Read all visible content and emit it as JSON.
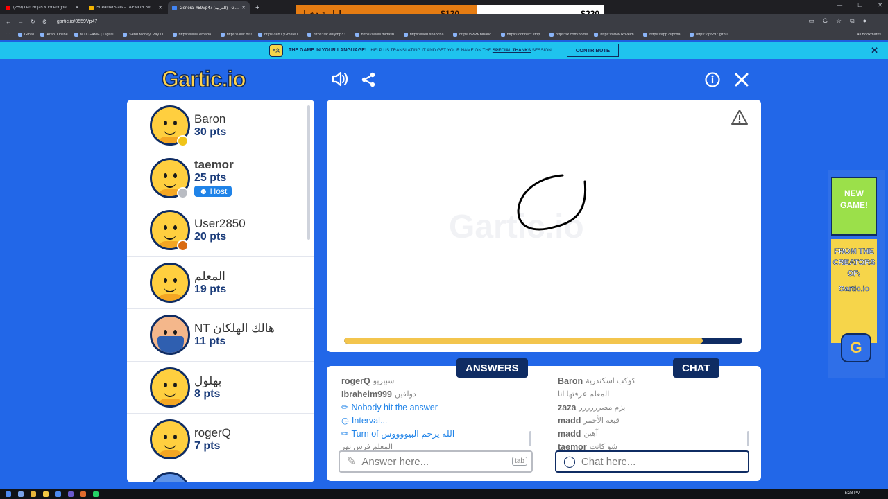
{
  "browser": {
    "tabs": [
      {
        "title": "(259) Leo Rojas & Gheorghe",
        "favicon_color": "#ff0000",
        "active": false
      },
      {
        "title": "StreamerStats - TAEMOR Stream",
        "favicon_color": "#f4b400",
        "active": false
      },
      {
        "title": "General #59Vp47 (العربية) - Gartic",
        "favicon_color": "#4285f4",
        "active": true
      }
    ],
    "new_tab": "+",
    "url": "gartic.io/0559Vp47",
    "bookmarks": [
      "Gmail",
      "Arabi Online",
      "MTCGAME | Digital...",
      "Send Money, Pay O...",
      "https://www.emada...",
      "https://3isk.biz/",
      "https://en1.y2mate.i...",
      "https://ar.onlymp3.t...",
      "https://www.midasb...",
      "https://web.snapcha...",
      "https://www.binanc...",
      "https://connect.strip...",
      "https://x.com/home",
      "https://www.ikoveim...",
      "https://app.clipcha...",
      "https://tpr297.githu..."
    ],
    "all_bookmarks": "All Bookmarks"
  },
  "overlay": {
    "label": "اولوية دخول",
    "left_amount": "$130",
    "right_amount": "$220"
  },
  "banner": {
    "lead": "THE GAME IN YOUR LANGUAGE!",
    "help": "HELP US TRANSLATING IT AND GET YOUR NAME ON THE",
    "special": "SPECIAL THANKS",
    "session": "SESSION",
    "contribute": "CONTRIBUTE",
    "close": "✕"
  },
  "game": {
    "logo": "Gartic.io",
    "watermark": "Gartic.io",
    "progress": 0.9,
    "players": [
      {
        "name": "Baron",
        "pts": "30 pts",
        "badge_color": "#f0c419",
        "bold": false
      },
      {
        "name": "taemor",
        "pts": "25 pts",
        "badge_color": "#b9bcc3",
        "bold": true,
        "host": "Host"
      },
      {
        "name": "User2850",
        "pts": "20 pts",
        "badge_color": "#d96b12",
        "bold": false
      },
      {
        "name": "المعلم",
        "pts": "19 pts",
        "badge_color": "",
        "bold": false
      },
      {
        "name": "NT هالك الهلكان",
        "pts": "11 pts",
        "badge_color": "",
        "bold": false,
        "avatar": "nt"
      },
      {
        "name": "بهلول",
        "pts": "8 pts",
        "badge_color": "",
        "bold": false
      },
      {
        "name": "rogerQ",
        "pts": "7 pts",
        "badge_color": "",
        "bold": false
      }
    ],
    "answers_label": "ANSWERS",
    "chat_label": "CHAT",
    "answers": [
      {
        "type": "user",
        "user": "rogerQ",
        "msg": "سبيريو"
      },
      {
        "type": "user",
        "user": "Ibraheim999",
        "msg": "دولفين"
      },
      {
        "type": "sys",
        "icon": "pencil",
        "text": "Nobody hit the answer"
      },
      {
        "type": "sys",
        "icon": "clock",
        "text": "Interval..."
      },
      {
        "type": "sys",
        "icon": "pencil",
        "text": "Turn of الله يرحم البيووووس"
      },
      {
        "type": "user",
        "user": "",
        "msg": "المعلم فرس نهر"
      }
    ],
    "chat": [
      {
        "user": "Baron",
        "msg": "كوكب اسكندرية"
      },
      {
        "user": "",
        "msg": "المعلم عرفتها انا"
      },
      {
        "user": "zaza",
        "msg": "بزم مصرررررر"
      },
      {
        "user": "madd",
        "msg": "قبعه الأحمر"
      },
      {
        "user": "madd",
        "msg": "آهين"
      },
      {
        "user": "taemor",
        "msg": "شو كانت"
      }
    ],
    "answer_placeholder": "Answer here...",
    "answer_key": "tab",
    "chat_placeholder": "Chat here..."
  },
  "ad": {
    "new_game": "NEW GAME!",
    "from": "FROM THE CREATORS OF:",
    "brand": "Gartic.io",
    "icon": "G"
  },
  "taskbar": {
    "time": "5:28 PM"
  }
}
